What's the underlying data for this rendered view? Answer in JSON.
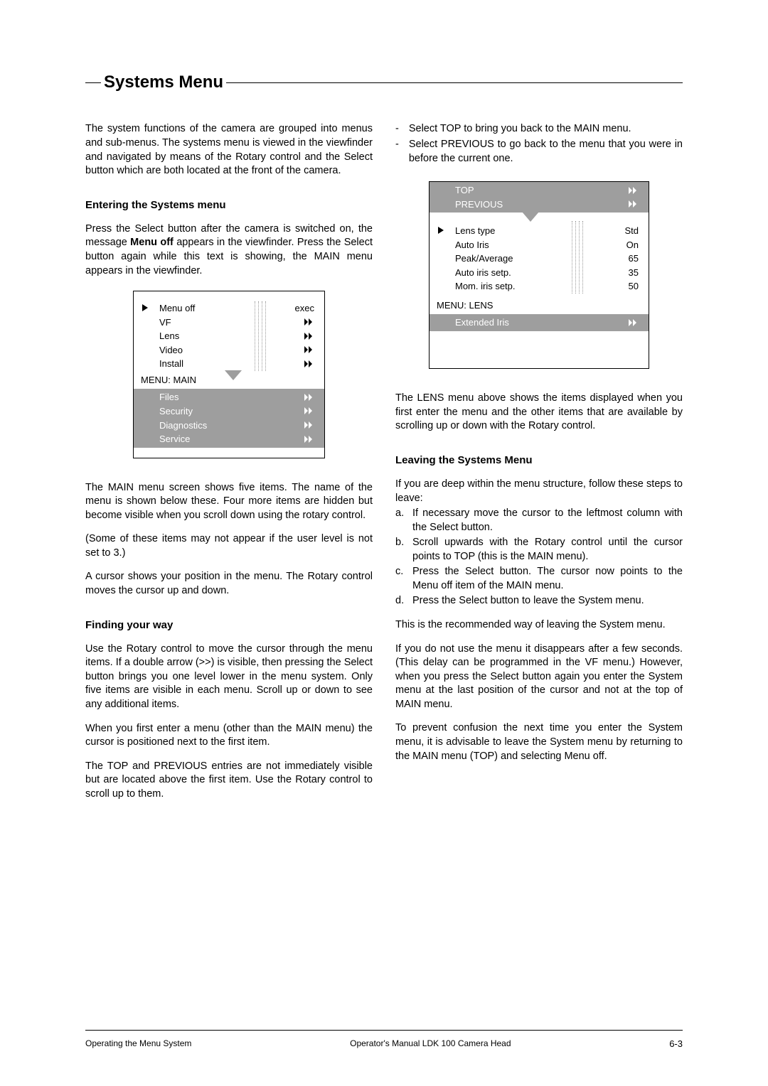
{
  "title": "Systems Menu",
  "intro_p": "The system functions of the camera are grouped into menus and sub-menus. The systems menu is viewed in the viewfinder and navigated by means of the Rotary control and the Select button which are both located at the front of the camera.",
  "h_entering": "Entering the Systems menu",
  "entering_p_pre": "Press the Select button after the camera is switched on, the message ",
  "entering_p_bold": "Menu off",
  "entering_p_post": " appears in the viewfinder. Press the Select button again while this text is showing, the MAIN menu appears in the viewfinder.",
  "main_diagram": {
    "rows": [
      {
        "label": "Menu off",
        "val": "exec",
        "pointer": true
      },
      {
        "label": "VF",
        "arrow": true
      },
      {
        "label": "Lens",
        "arrow": true
      },
      {
        "label": "Video",
        "arrow": true
      },
      {
        "label": "Install",
        "arrow": true
      }
    ],
    "title": "MENU:   MAIN",
    "below": [
      {
        "label": "Files",
        "arrow": true
      },
      {
        "label": "Security",
        "arrow": true
      },
      {
        "label": "Diagnostics",
        "arrow": true
      },
      {
        "label": "Service",
        "arrow": true
      }
    ]
  },
  "main_p1": "The MAIN menu screen shows five items. The name of the menu is shown below these. Four more items are hidden but become visible when you scroll down using the rotary control.",
  "main_p2": "(Some of these items may not appear if the user level is not set to 3.)",
  "main_p3": "A cursor shows your position in the menu. The Rotary control moves the cursor up and down.",
  "h_finding": "Finding your way",
  "finding_p1": "Use the Rotary control to move the cursor through the menu items. If a double arrow (>>) is visible, then pressing the Select button brings you one level lower in the menu system. Only five items are visible in each menu. Scroll up or down to see any additional items.",
  "finding_p2": "When you first enter a menu (other than the MAIN menu) the cursor is positioned next to the first item.",
  "finding_p3": " The TOP and PREVIOUS entries are not immediately visible but are located above the first item. Use the Rotary control to scroll up to them.",
  "nav_list": [
    "Select TOP to bring you back to the MAIN menu.",
    "Select PREVIOUS to go back to the menu that you were in before the current one."
  ],
  "lens_diagram": {
    "above": [
      {
        "label": "TOP",
        "arrow": true
      },
      {
        "label": "PREVIOUS",
        "arrow": true
      }
    ],
    "rows": [
      {
        "label": "Lens type",
        "val": "Std",
        "pointer": true
      },
      {
        "label": "Auto Iris",
        "val": "On"
      },
      {
        "label": "Peak/Average",
        "val": "65"
      },
      {
        "label": "Auto iris setp.",
        "val": "35"
      },
      {
        "label": "Mom. iris setp.",
        "val": "50"
      }
    ],
    "title": "MENU:   LENS",
    "below": [
      {
        "label": "Extended Iris",
        "arrow": true
      }
    ]
  },
  "lens_p": "The LENS menu above shows the items displayed when you first enter the menu and the other items that are available by scrolling up or down with the Rotary control.",
  "h_leaving": "Leaving the Systems Menu",
  "leaving_intro": "If you are deep within the menu structure, follow these steps to leave:",
  "leaving_steps": [
    "If necessary move the cursor to the leftmost column with the Select button.",
    "Scroll upwards with the Rotary control until the cursor points to TOP (this is the MAIN menu).",
    "Press the Select button. The cursor now points to the Menu off item of the MAIN menu.",
    "Press the Select button to leave the System menu."
  ],
  "leaving_letters": [
    "a.",
    "b.",
    "c.",
    "d."
  ],
  "leaving_p1": "This is the recommended way of leaving the System menu.",
  "leaving_p2": "If you do not use the menu it disappears after a few seconds. (This delay can be programmed in the VF menu.) However, when you press the Select button again you enter the System menu at the last position of the cursor and not at the top of MAIN menu.",
  "leaving_p3": "To prevent confusion the next time you enter the System menu, it is advisable to leave the System menu by returning to the MAIN menu (TOP) and selecting Menu off.",
  "footer_left": "Operating the Menu System",
  "footer_center": "Operator's Manual LDK 100 Camera Head",
  "footer_page": "6-3"
}
